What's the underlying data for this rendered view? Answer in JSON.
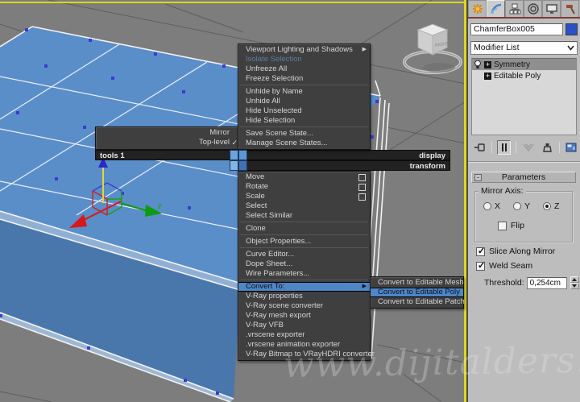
{
  "watermark": {
    "text": "www.dijitalders.com"
  },
  "viewport": {
    "viewcube": {
      "face_label": "RIGHT"
    },
    "gizmo": {
      "y_axis_label": "y"
    },
    "quad_menu": {
      "quadrant_labels": {
        "tools": "tools 1",
        "display": "display",
        "transform": "transform"
      },
      "tools_items": [
        {
          "label": "Mirror"
        },
        {
          "label": "Top-level",
          "checked": true
        }
      ],
      "display_items": [
        {
          "label": "Viewport Lighting and Shadows",
          "submenu": true
        },
        {
          "label": "Isolate Selection",
          "disabled": true
        },
        {
          "label": "Unfreeze All"
        },
        {
          "label": "Freeze Selection",
          "sep": true
        },
        {
          "label": "Unhide by Name"
        },
        {
          "label": "Unhide All"
        },
        {
          "label": "Hide Unselected"
        },
        {
          "label": "Hide Selection",
          "sep": true
        },
        {
          "label": "Save Scene State..."
        },
        {
          "label": "Manage Scene States..."
        }
      ],
      "transform_items": [
        {
          "label": "Move",
          "settings": true
        },
        {
          "label": "Rotate",
          "settings": true
        },
        {
          "label": "Scale",
          "settings": true
        },
        {
          "label": "Select"
        },
        {
          "label": "Select Similar",
          "sep": true
        },
        {
          "label": "Clone",
          "sep": true
        },
        {
          "label": "Object Properties...",
          "sep": true
        },
        {
          "label": "Curve Editor..."
        },
        {
          "label": "Dope Sheet..."
        },
        {
          "label": "Wire Parameters...",
          "sep": true
        },
        {
          "label": "Convert To:",
          "submenu": true,
          "highlighted": true
        },
        {
          "label": "V-Ray properties"
        },
        {
          "label": "V-Ray scene converter"
        },
        {
          "label": "V-Ray mesh export"
        },
        {
          "label": "V-Ray VFB"
        },
        {
          "label": ".vrscene exporter"
        },
        {
          "label": ".vrscene animation exporter"
        },
        {
          "label": "V-Ray Bitmap to VRayHDRI converter"
        }
      ],
      "convert_submenu": [
        {
          "label": "Convert to Editable Mesh"
        },
        {
          "label": "Convert to Editable Poly",
          "highlighted": true
        },
        {
          "label": "Convert to Editable Patch"
        }
      ]
    }
  },
  "command_panel": {
    "tabs": [
      {
        "name": "create",
        "icon": "sunburst-icon"
      },
      {
        "name": "modify",
        "icon": "modify-arc-icon",
        "active": true
      },
      {
        "name": "hierarchy",
        "icon": "hierarchy-boxes-icon"
      },
      {
        "name": "motion",
        "icon": "concentric-circles-icon"
      },
      {
        "name": "display",
        "icon": "monitor-icon"
      },
      {
        "name": "utilities",
        "icon": "hammer-icon"
      }
    ],
    "object_name_field": {
      "value": "ChamferBox005",
      "color_swatch": "#2b50c8"
    },
    "modifier_list": {
      "label": "Modifier List"
    },
    "modifier_stack": {
      "rows": [
        {
          "label": "Symmetry",
          "selected": true,
          "visible": true
        },
        {
          "label": "Editable Poly"
        }
      ]
    },
    "stack_tools": [
      "pin-stack",
      "show-end-result",
      "make-unique",
      "remove-modifier",
      "configure-modifier-sets"
    ],
    "parameters": {
      "rollout_title": "Parameters",
      "mirror_axis": {
        "legend": "Mirror Axis:",
        "options": [
          "X",
          "Y",
          "Z"
        ],
        "selected": "Z",
        "flip_label": "Flip",
        "flip_checked": false
      },
      "slice_along_mirror": {
        "label": "Slice Along Mirror",
        "checked": true
      },
      "weld_seam": {
        "label": "Weld Seam",
        "checked": true
      },
      "threshold": {
        "label": "Threshold:",
        "value": "0,254cm"
      }
    }
  },
  "colors": {
    "viewport_bg": "#7d7d7d",
    "active_viewport_border": "#ded61e",
    "menu_bg": "#3f3f3f",
    "menu_highlight": "#4f86c6",
    "box_top_face": "#5a8ec9",
    "box_front_face": "#4a77ab",
    "panel_bg": "#bdbdbd",
    "object_color": "#2b50c8"
  }
}
